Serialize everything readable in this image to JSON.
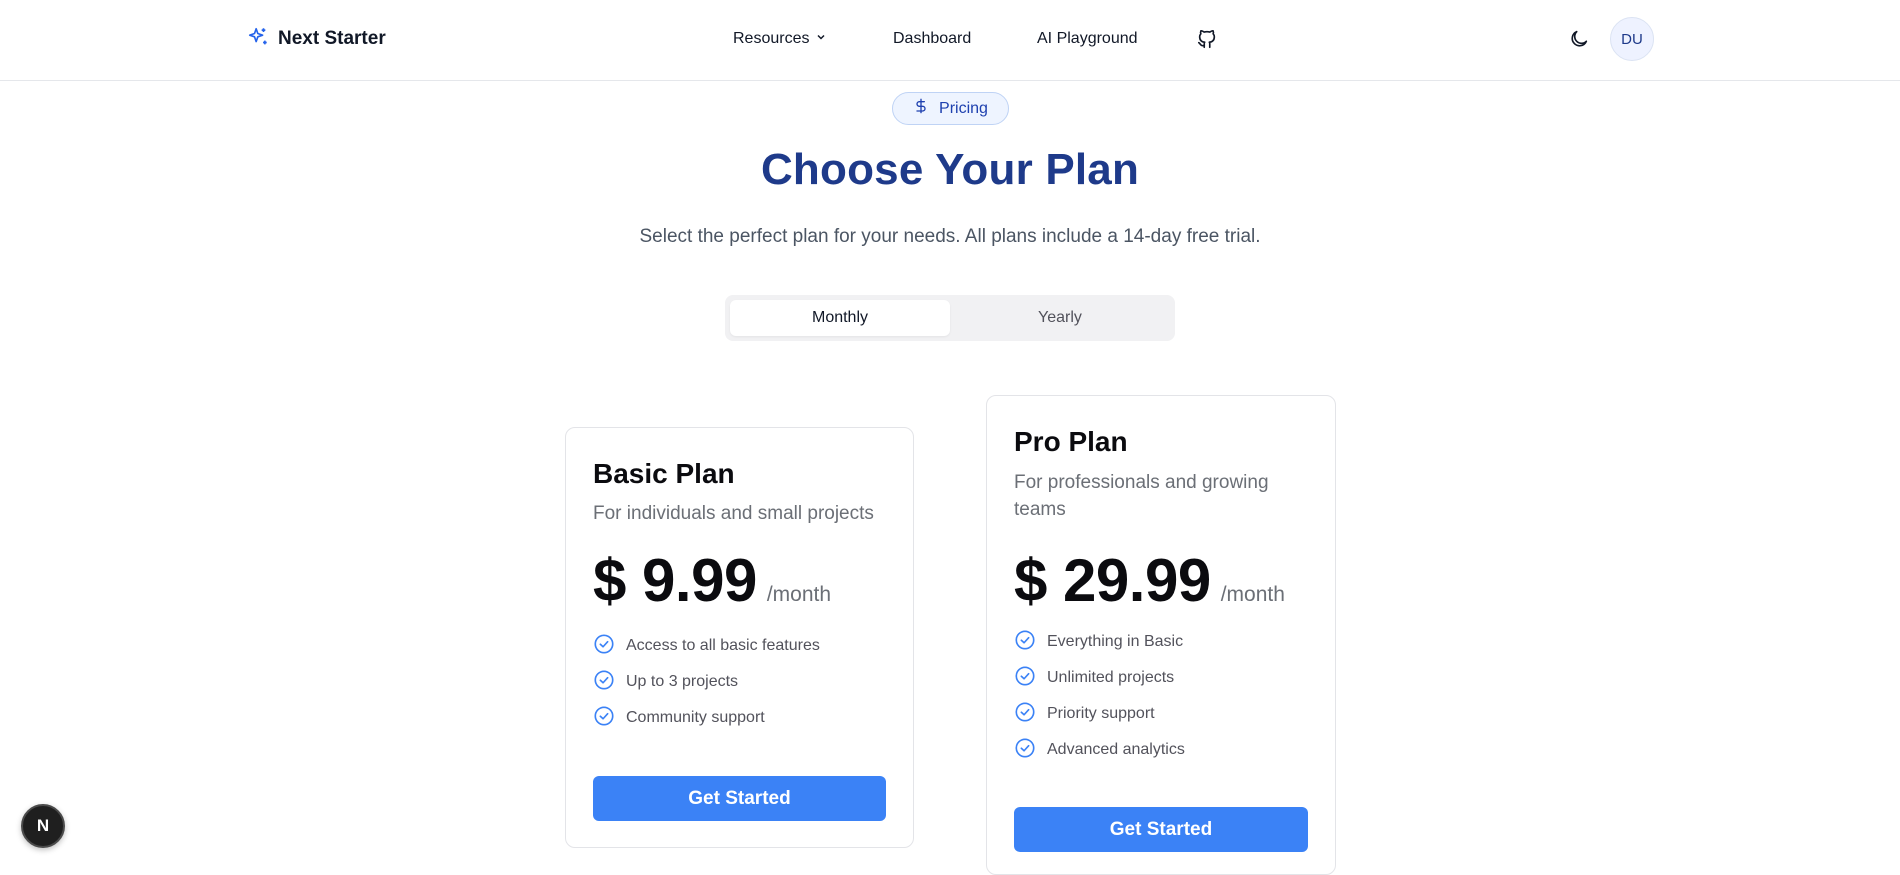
{
  "header": {
    "brand": "Next Starter",
    "nav": [
      {
        "label": "Resources"
      },
      {
        "label": "Dashboard"
      },
      {
        "label": "AI Playground"
      }
    ],
    "avatar_initials": "DU"
  },
  "hero": {
    "badge": "Pricing",
    "title": "Choose Your Plan",
    "subtitle": "Select the perfect plan for your needs. All plans include a 14-day free trial."
  },
  "billing_toggle": {
    "options": [
      "Monthly",
      "Yearly"
    ],
    "selected": "Monthly"
  },
  "plans": [
    {
      "name": "Basic Plan",
      "description": "For individuals and small projects",
      "price": "$ 9.99",
      "period": "/month",
      "features": [
        "Access to all basic features",
        "Up to 3 projects",
        "Community support"
      ],
      "cta": "Get Started"
    },
    {
      "name": "Pro Plan",
      "description": "For professionals and growing teams",
      "price": "$ 29.99",
      "period": "/month",
      "features": [
        "Everything in Basic",
        "Unlimited projects",
        "Priority support",
        "Advanced analytics"
      ],
      "cta": "Get Started"
    }
  ],
  "dev_badge": "N",
  "colors": {
    "accent": "#3b82f6",
    "title": "#1e3a8a"
  }
}
